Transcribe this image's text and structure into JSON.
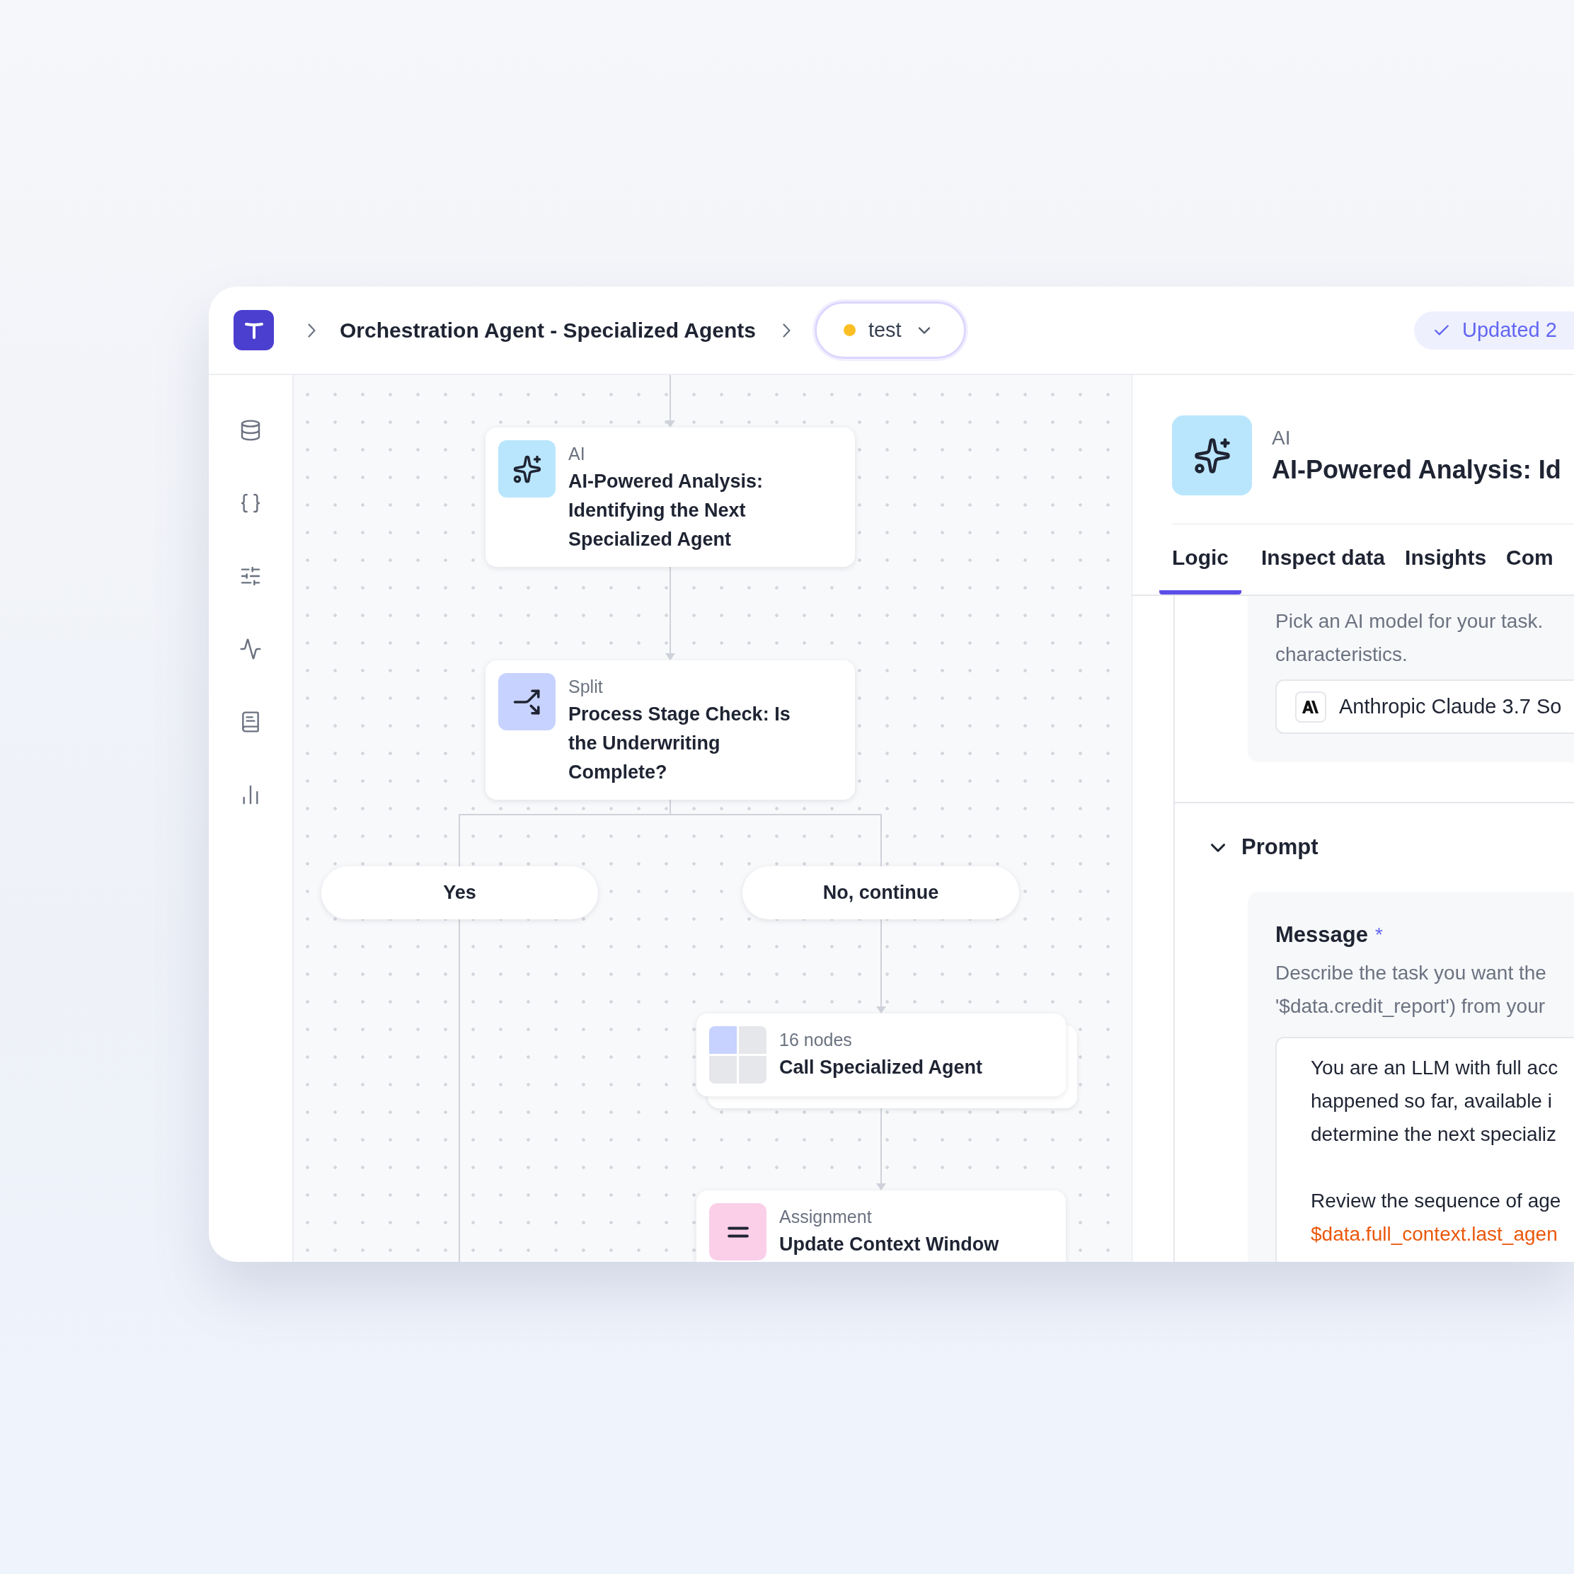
{
  "header": {
    "breadcrumb": "Orchestration Agent - Specialized Agents",
    "environment": {
      "label": "test"
    },
    "save_status": "Updated 2"
  },
  "canvas": {
    "nodes": [
      {
        "kind": "ai",
        "type_label": "AI",
        "title": "AI-Powered Analysis: Identifying the Next Specialized Agent"
      },
      {
        "kind": "split",
        "type_label": "Split",
        "title": "Process Stage Check: Is the Underwriting Complete?"
      },
      {
        "kind": "group",
        "type_label": "16 nodes",
        "title": "Call Specialized Agent"
      },
      {
        "kind": "assignment",
        "type_label": "Assignment",
        "title": "Update Context Window"
      }
    ],
    "branches": [
      "Yes",
      "No, continue"
    ]
  },
  "panel": {
    "node_type": "AI",
    "title": "AI-Powered Analysis: Id",
    "tabs": [
      {
        "label": "Logic",
        "selected": true
      },
      {
        "label": "Inspect data",
        "selected": false
      },
      {
        "label": "Insights",
        "selected": false
      },
      {
        "label": "Com",
        "selected": false
      }
    ],
    "model_description": [
      "Pick an AI model for your task.",
      "characteristics."
    ],
    "model": "Anthropic Claude 3.7 So",
    "prompt_section": {
      "title": "Prompt",
      "expanded": true
    },
    "message": {
      "label": "Message",
      "required": true,
      "required_mark": "*",
      "description": [
        "Describe the task you want the",
        "'$data.credit_report') from your"
      ],
      "paragraphs": [
        [
          {
            "kind": "text",
            "text": "You are an LLM with full acc"
          },
          {
            "kind": "text",
            "text": "happened so far, available i"
          },
          {
            "kind": "text",
            "text": "determine the next specializ"
          }
        ],
        [
          {
            "kind": "text",
            "text": "Review the sequence of age"
          },
          {
            "kind": "variable",
            "text": "$data.full_context.last_agen"
          }
        ]
      ]
    }
  }
}
